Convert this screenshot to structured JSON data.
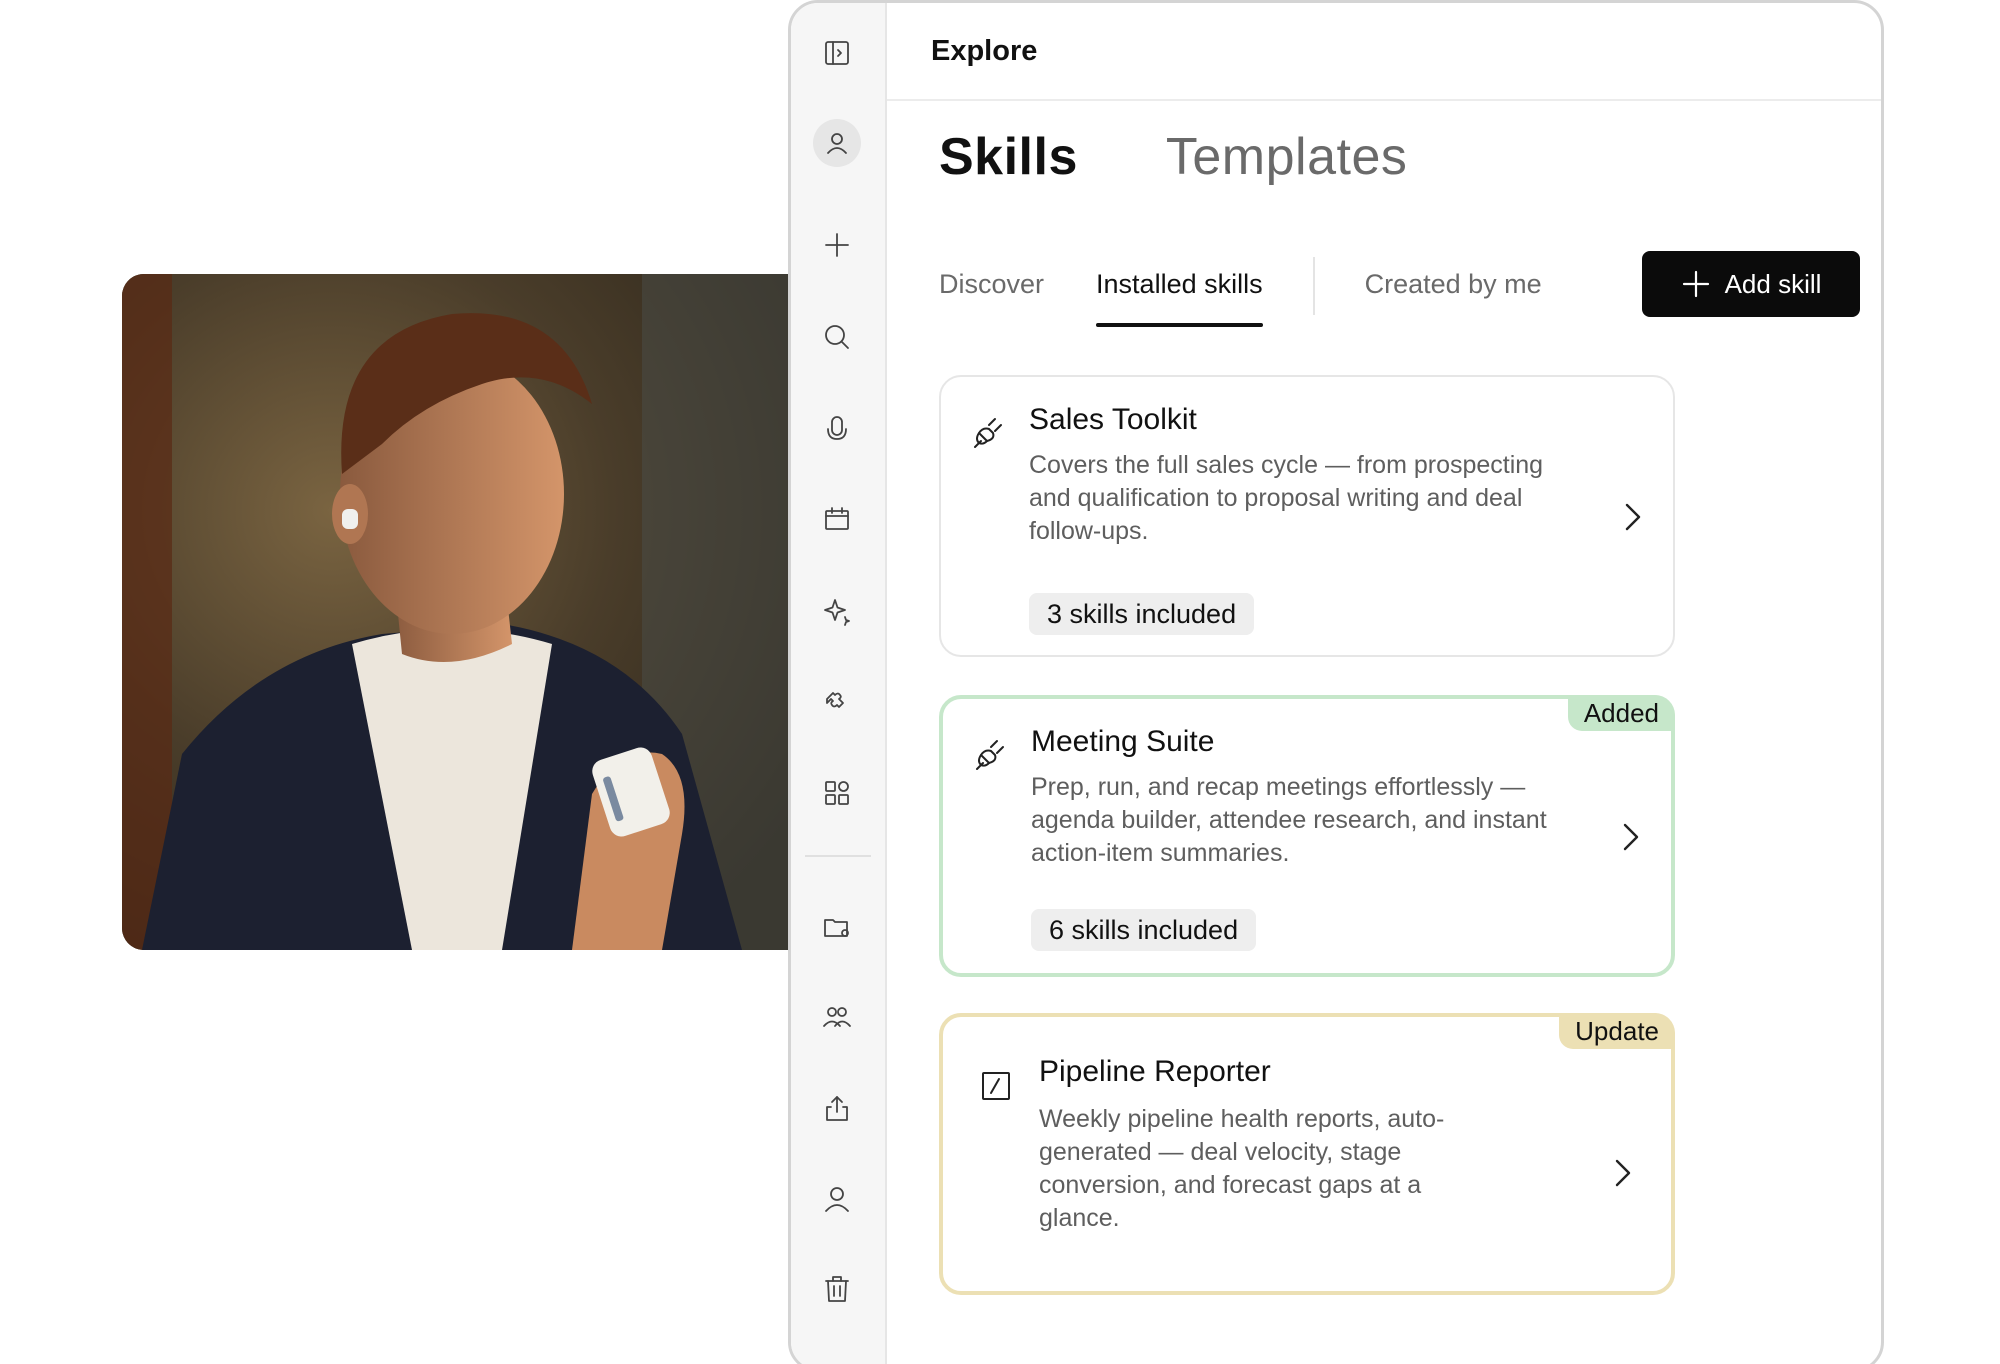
{
  "app": {
    "title": "Explore"
  },
  "tabs": {
    "primary": [
      {
        "label": "Skills",
        "active": true
      },
      {
        "label": "Templates",
        "active": false
      }
    ],
    "secondary": [
      {
        "label": "Discover",
        "active": false
      },
      {
        "label": "Installed skills",
        "active": true
      },
      {
        "label": "Created by me",
        "active": false
      }
    ]
  },
  "actions": {
    "add_skill": "Add skill"
  },
  "sidebar": {
    "icons": [
      "sidebar-toggle-icon",
      "profile-icon",
      "plus-icon",
      "search-icon",
      "microphone-icon",
      "calendar-icon",
      "sparkle-icon",
      "puzzle-icon",
      "apps-grid-icon",
      "folder-settings-icon",
      "people-icon",
      "share-icon",
      "user-icon",
      "trash-icon"
    ]
  },
  "cards": [
    {
      "title": "Sales Toolkit",
      "description": "Covers the full sales cycle — from prospecting and qualification to proposal writing and deal follow-ups.",
      "chip": "3 skills included",
      "tag": null,
      "icon": "plug-icon"
    },
    {
      "title": "Meeting Suite",
      "description": "Prep, run, and recap meetings effortlessly — agenda builder, attendee research, and instant action-item summaries.",
      "chip": "6 skills included",
      "tag": "Added",
      "icon": "plug-icon"
    },
    {
      "title": "Pipeline Reporter",
      "description": "Weekly pipeline health reports, auto-generated — deal velocity, stage conversion, and forecast gaps at a glance.",
      "chip": null,
      "tag": "Update",
      "icon": "edit-square-icon"
    }
  ],
  "colors": {
    "primary_button": "#0b0b0b",
    "added_tag": "#c6e7ca",
    "update_tag": "#ece0b4"
  }
}
